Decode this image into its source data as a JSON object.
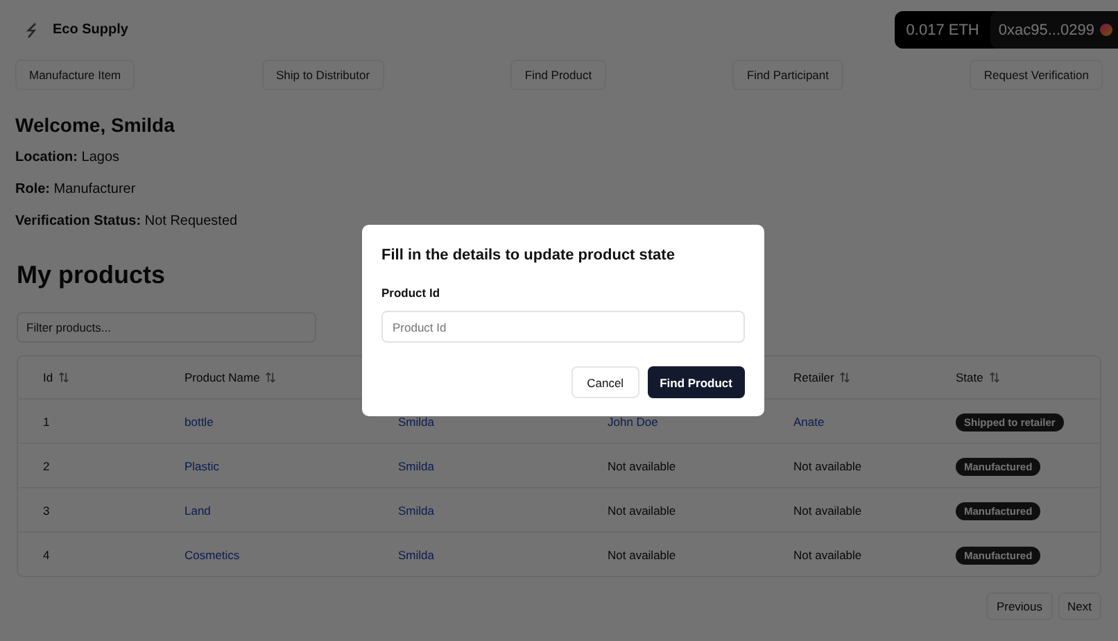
{
  "header": {
    "brand": "Eco Supply",
    "wallet": {
      "balance": "0.017 ETH",
      "address": "0xac95...0299"
    }
  },
  "nav": [
    "Manufacture Item",
    "Ship to Distributor",
    "Find Product",
    "Find Participant",
    "Request Verification"
  ],
  "profile": {
    "welcome": "Welcome, Smilda",
    "fields": [
      {
        "label": "Location:",
        "value": "Lagos"
      },
      {
        "label": "Role:",
        "value": "Manufacturer"
      },
      {
        "label": "Verification Status:",
        "value": "Not Requested"
      }
    ]
  },
  "products": {
    "title": "My products",
    "filter": {
      "placeholder": "Filter products..."
    },
    "columns": [
      {
        "label": "Id"
      },
      {
        "label": "Product Name"
      },
      {},
      {},
      {
        "label": "Retailer"
      },
      {
        "label": "State"
      }
    ],
    "rows": [
      {
        "cells": [
          {
            "text": "1",
            "kind": "plain"
          },
          {
            "text": "bottle",
            "kind": "link"
          },
          {
            "text": "Smilda",
            "kind": "link"
          },
          {
            "text": "John Doe",
            "kind": "link"
          },
          {
            "text": "Anate",
            "kind": "link"
          },
          {
            "text": "Shipped to retailer",
            "kind": "badge"
          }
        ]
      },
      {
        "cells": [
          {
            "text": "2",
            "kind": "plain"
          },
          {
            "text": "Plastic",
            "kind": "link"
          },
          {
            "text": "Smilda",
            "kind": "link"
          },
          {
            "text": "Not available",
            "kind": "plain"
          },
          {
            "text": "Not available",
            "kind": "plain"
          },
          {
            "text": "Manufactured",
            "kind": "badge"
          }
        ]
      },
      {
        "cells": [
          {
            "text": "3",
            "kind": "plain"
          },
          {
            "text": "Land",
            "kind": "link"
          },
          {
            "text": "Smilda",
            "kind": "link"
          },
          {
            "text": "Not available",
            "kind": "plain"
          },
          {
            "text": "Not available",
            "kind": "plain"
          },
          {
            "text": "Manufactured",
            "kind": "badge"
          }
        ]
      },
      {
        "cells": [
          {
            "text": "4",
            "kind": "plain"
          },
          {
            "text": "Cosmetics",
            "kind": "link"
          },
          {
            "text": "Smilda",
            "kind": "link"
          },
          {
            "text": "Not available",
            "kind": "plain"
          },
          {
            "text": "Not available",
            "kind": "plain"
          },
          {
            "text": "Manufactured",
            "kind": "badge"
          }
        ]
      }
    ],
    "pagination": [
      "Previous",
      "Next"
    ]
  },
  "dialog": {
    "title": "Fill in the details to update product state",
    "field": {
      "label": "Product Id",
      "placeholder": "Product Id"
    },
    "cancel": "Cancel",
    "submit": "Find Product"
  }
}
